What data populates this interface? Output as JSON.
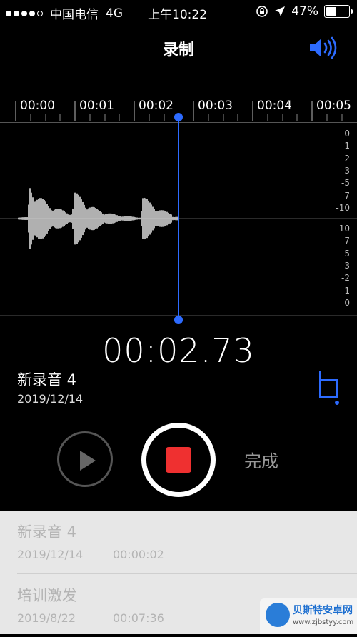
{
  "status_bar": {
    "carrier": "中国电信",
    "network": "4G",
    "time": "上午10:22",
    "battery": "47%",
    "battery_level": 0.47
  },
  "header": {
    "title": "录制",
    "speaker_icon": "speaker-volume-icon"
  },
  "timeline": {
    "ticks": [
      "00:00",
      "00:01",
      "00:02",
      "00:03",
      "00:04",
      "00:05"
    ]
  },
  "db_scale": {
    "top": [
      "0",
      "-1",
      "-2",
      "-3",
      "-5",
      "-7",
      "-10"
    ],
    "bottom": [
      "-10",
      "-7",
      "-5",
      "-3",
      "-2",
      "-1",
      "0"
    ]
  },
  "recording": {
    "timer": "00:02.73",
    "name": "新录音 4",
    "date": "2019/12/14",
    "done_label": "完成"
  },
  "recordings_list": [
    {
      "name": "新录音 4",
      "date": "2019/12/14",
      "duration": "00:00:02"
    },
    {
      "name": "培训激发",
      "date": "2019/8/22",
      "duration": "00:07:36"
    }
  ],
  "watermark": {
    "title": "贝斯特安卓网",
    "url": "www.zjbstyy.com"
  },
  "colors": {
    "accent": "#2d6bff",
    "record": "#ef3030"
  }
}
